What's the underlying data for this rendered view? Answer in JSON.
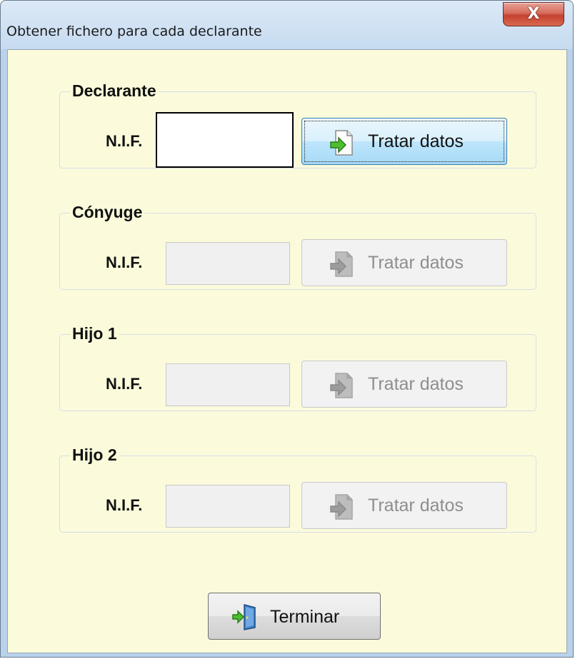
{
  "window": {
    "title": "Obtener fichero para cada declarante",
    "close_label": "X"
  },
  "groups": [
    {
      "label": "Declarante",
      "nif_label": "N.I.F.",
      "nif_value": "",
      "button_label": "Tratar datos",
      "enabled": true
    },
    {
      "label": "Cónyuge",
      "nif_label": "N.I.F.",
      "nif_value": "",
      "button_label": "Tratar datos",
      "enabled": false
    },
    {
      "label": "Hijo 1",
      "nif_label": "N.I.F.",
      "nif_value": "",
      "button_label": "Tratar datos",
      "enabled": false
    },
    {
      "label": "Hijo 2",
      "nif_label": "N.I.F.",
      "nif_value": "",
      "button_label": "Tratar datos",
      "enabled": false
    }
  ],
  "footer": {
    "terminar_label": "Terminar"
  },
  "icons": {
    "tratar": "document-arrow-icon",
    "terminar": "exit-door-icon"
  },
  "colors": {
    "client_background": "#fbfbdc",
    "active_button_border": "#3c7fb1",
    "disabled_text": "#8e8e8e"
  }
}
